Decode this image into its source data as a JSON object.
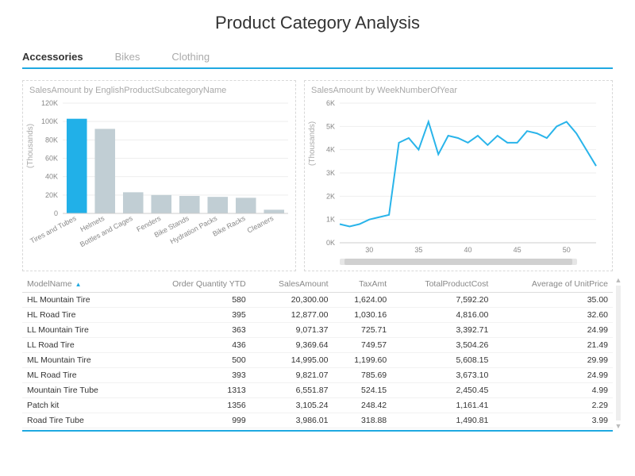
{
  "title": "Product Category Analysis",
  "tabs": [
    "Accessories",
    "Bikes",
    "Clothing"
  ],
  "active_tab": 0,
  "chart_data": [
    {
      "id": "bar",
      "type": "bar",
      "title": "SalesAmount by EnglishProductSubcategoryName",
      "ylabel": "(Thousands)",
      "ylim": [
        0,
        120
      ],
      "yticks": [
        0,
        "20K",
        "40K",
        "60K",
        "80K",
        "100K",
        "120K"
      ],
      "categories": [
        "Tires and Tubes",
        "Helmets",
        "Bottles and Cages",
        "Fenders",
        "Bike Stands",
        "Hydration Packs",
        "Bike Racks",
        "Cleaners"
      ],
      "values": [
        103,
        92,
        23,
        20,
        19,
        18,
        17,
        4
      ],
      "highlight_index": 0
    },
    {
      "id": "line",
      "type": "line",
      "title": "SalesAmount by WeekNumberOfYear",
      "ylabel": "(Thousands)",
      "ylim": [
        0,
        6
      ],
      "yticks": [
        "0K",
        "1K",
        "2K",
        "3K",
        "4K",
        "5K",
        "6K"
      ],
      "xticks": [
        30,
        35,
        40,
        45,
        50
      ],
      "x": [
        27,
        28,
        29,
        30,
        31,
        32,
        33,
        34,
        35,
        36,
        37,
        38,
        39,
        40,
        41,
        42,
        43,
        44,
        45,
        46,
        47,
        48,
        49,
        50,
        51,
        52,
        53
      ],
      "values": [
        0.8,
        0.7,
        0.8,
        1.0,
        1.1,
        1.2,
        4.3,
        4.5,
        4.0,
        5.2,
        3.8,
        4.6,
        4.5,
        4.3,
        4.6,
        4.2,
        4.6,
        4.3,
        4.3,
        4.8,
        4.7,
        4.5,
        5.0,
        5.2,
        4.7,
        4.0,
        3.3
      ]
    }
  ],
  "table": {
    "columns": [
      "ModelName",
      "Order Quantity YTD",
      "SalesAmount",
      "TaxAmt",
      "TotalProductCost",
      "Average of UnitPrice"
    ],
    "sort_column": 0,
    "rows": [
      [
        "HL Mountain Tire",
        "580",
        "20,300.00",
        "1,624.00",
        "7,592.20",
        "35.00"
      ],
      [
        "HL Road Tire",
        "395",
        "12,877.00",
        "1,030.16",
        "4,816.00",
        "32.60"
      ],
      [
        "LL Mountain Tire",
        "363",
        "9,071.37",
        "725.71",
        "3,392.71",
        "24.99"
      ],
      [
        "LL Road Tire",
        "436",
        "9,369.64",
        "749.57",
        "3,504.26",
        "21.49"
      ],
      [
        "ML Mountain Tire",
        "500",
        "14,995.00",
        "1,199.60",
        "5,608.15",
        "29.99"
      ],
      [
        "ML Road Tire",
        "393",
        "9,821.07",
        "785.69",
        "3,673.10",
        "24.99"
      ],
      [
        "Mountain Tire Tube",
        "1313",
        "6,551.87",
        "524.15",
        "2,450.45",
        "4.99"
      ],
      [
        "Patch kit",
        "1356",
        "3,105.24",
        "248.42",
        "1,161.41",
        "2.29"
      ],
      [
        "Road Tire Tube",
        "999",
        "3,986.01",
        "318.88",
        "1,490.81",
        "3.99"
      ]
    ]
  }
}
